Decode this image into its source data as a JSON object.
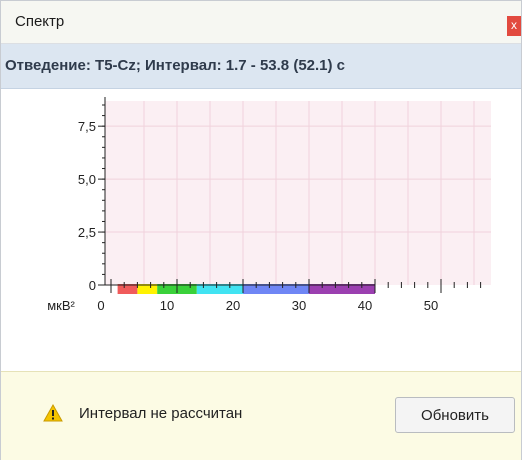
{
  "window": {
    "title": "Спектр",
    "close_label": "x"
  },
  "info": {
    "text": "Отведение: T5-Cz; Интервал: 1.7 - 53.8 (52.1) с"
  },
  "chart_data": {
    "type": "bar",
    "title": "",
    "xlabel": "",
    "ylabel": "мкВ²",
    "y_ticks": [
      "7,5",
      "5,0",
      "2,5",
      "0"
    ],
    "y_tick_values": [
      7.5,
      5.0,
      2.5,
      0
    ],
    "ylim": [
      0,
      8.5
    ],
    "x_ticks": [
      "0",
      "10",
      "20",
      "30",
      "40",
      "50"
    ],
    "x_tick_values": [
      0,
      10,
      20,
      30,
      40,
      50
    ],
    "xlim": [
      0,
      60
    ],
    "values": [],
    "grid": true,
    "frequency_bands": [
      {
        "from": 1,
        "to": 4,
        "color": "#f05b5b"
      },
      {
        "from": 4,
        "to": 7,
        "color": "#fff200"
      },
      {
        "from": 7,
        "to": 13,
        "color": "#3ad13a"
      },
      {
        "from": 13,
        "to": 20,
        "color": "#41e3f2"
      },
      {
        "from": 20,
        "to": 30,
        "color": "#6f86f5"
      },
      {
        "from": 30,
        "to": 40,
        "color": "#9b3fb0"
      }
    ]
  },
  "footer": {
    "warning_icon": "warning-triangle-icon",
    "warning_text": "Интервал не рассчитан",
    "refresh_label": "Обновить"
  },
  "colors": {
    "plot_background": "#fbeff3",
    "grid": "#f0d2dc",
    "warning_background": "#fcfbe4",
    "header_background": "#dce6f1"
  }
}
